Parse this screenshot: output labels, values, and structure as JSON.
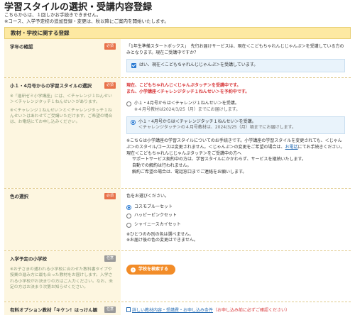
{
  "page": {
    "title": "学習スタイルの選択・受講内容登録",
    "intro": [
      "こちらからは、１回しかお手続きできません。",
      "※コース、入学予定校の追加登録・変更は、秋以降にご案内を開始いたします。"
    ]
  },
  "section": {
    "header": "教材・学校に関する登録"
  },
  "badges": {
    "required": "必須",
    "optional": "任意"
  },
  "grade_confirm": {
    "label": "学年の確認",
    "text": "「1年生準備スタートボックス」　先行お届けサービスは、現在＜こどもちゃれんじじゃんぷ＞を受講している方のみとなります。現在ご受講中ですか？",
    "checkbox_label": "はい、現在＜こどもちゃれんじじゃんぷ＞を受講しています。"
  },
  "learning_style": {
    "label": "小１・4月号からの学習スタイルの選択",
    "note": "※「進研ゼミ小学講座」には、＜チャレンジ１ねんせい＞＜チャレンジタッチ１ねんせい＞があります。",
    "note2": "※＜チャレンジ１ねんせい＞と＜チャレンジタッチ１ねんせい＞はあわせてご受講いただけます。ご希望の場合は、お電話にてお申し込みください。",
    "warning1": "現在、こどもちゃれんじ＜じゃんぷタッチ＞を受講中です。",
    "warning2": "また、小学講座＜チャレンジタッチ１ねんせい＞を予約中です。",
    "option1": "小１・4月号からは＜チャレンジ１ねんせい＞を受講。",
    "option1_sub": "※４月号教材は2024/3/25（月）までにお届けします。",
    "option2": "小１・4月号からは＜チャレンジタッチ１ねんせい＞を受講。",
    "option2_sub": "＜チャレンジタッチ＞の４月号教材は、2024/3/25（月）頃までにお届けします。",
    "info1_a": "※こちらは小学講座の学習スタイルについてのお手続きです。小学講座の学習スタイルを変更されても、＜じゃんぷ＞のスタイル/コースは変更されません。＜じゃんぷ＞の変更をご希望の場合は、",
    "info1_link": "お電話",
    "info1_b": "にてお手続きください。",
    "info2": "現在＜こどもちゃれんじじゃんぷタッチ＞をご受講中の方へ",
    "info3": "サポートサービス契約中の方は、学習スタイルにかかわらず、サービスを継続いたします。",
    "info4": "自動での解約は行われません。",
    "info5": "解約ご希望の場合は、電話窓口までご連絡をお願いします。"
  },
  "color_select": {
    "label": "色の選択",
    "prompt": "色をお選びください。",
    "options": [
      "コスモブルーセット",
      "ハッピーピンクセット",
      "シャイニースカイセット"
    ],
    "selected_index": 0,
    "note1": "※ひとつのみ別の色は選べません。",
    "note2": "※お届け後の色の変更はできません。"
  },
  "school": {
    "label": "入学予定の小学校",
    "note": "※お子さまの通われる小学校に合わせた教科書タイプや授業の進み方に最も合った教材をお届けします。入学される小学校がお決まりの方はご入力ください。なお、未定の方はお決まり次第お知らせください。",
    "button": "学校を検索する"
  },
  "paid_option": {
    "label": "有料オプション教材「キケン！はっけん観",
    "link": "詳しい教材内容・受講費・お申し込み条件",
    "link_note": "（お申し込み前に必ずご確認ください）"
  },
  "colors": {
    "accent": "#f28c28",
    "header_bg": "#fde9a2",
    "label_bg": "#fdf6e0",
    "warning": "#d8383a",
    "link": "#2a6fb5"
  }
}
